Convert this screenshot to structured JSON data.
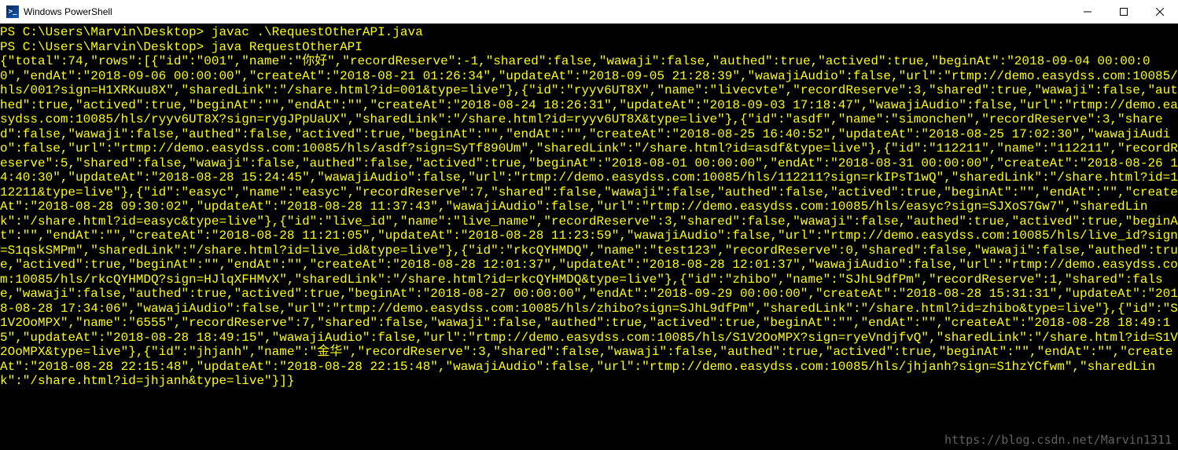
{
  "window": {
    "title": "Windows PowerShell",
    "icon_label": ">_"
  },
  "commands": [
    {
      "prompt": "PS C:\\Users\\Marvin\\Desktop> ",
      "cmd": "javac .\\RequestOtherAPI.java"
    },
    {
      "prompt": "PS C:\\Users\\Marvin\\Desktop> ",
      "cmd": "java RequestOtherAPI"
    }
  ],
  "json_output": {
    "total": 74,
    "rows": [
      {
        "id": "001",
        "name": "你好",
        "recordReserve": -1,
        "shared": false,
        "wawaji": false,
        "authed": true,
        "actived": true,
        "beginAt": "2018-09-04 00:00:00",
        "endAt": "2018-09-06 00:00:00",
        "createAt": "2018-08-21 01:26:34",
        "updateAt": "2018-09-05 21:28:39",
        "wawajiAudio": false,
        "url": "rtmp://demo.easydss.com:10085/hls/001?sign=H1XRKuu8X",
        "sharedLink": "/share.html?id=001&type=live"
      },
      {
        "id": "ryyv6UT8X",
        "name": "livecvte",
        "recordReserve": 3,
        "shared": true,
        "wawaji": false,
        "authed": true,
        "actived": true,
        "beginAt": "",
        "endAt": "",
        "createAt": "2018-08-24 18:26:31",
        "updateAt": "2018-09-03 17:18:47",
        "wawajiAudio": false,
        "url": "rtmp://demo.easydss.com:10085/hls/ryyv6UT8X?sign=rygJPpUaUX",
        "sharedLink": "/share.html?id=ryyv6UT8X&type=live"
      },
      {
        "id": "asdf",
        "name": "simonchen",
        "recordReserve": 3,
        "shared": false,
        "wawaji": false,
        "authed": false,
        "actived": true,
        "beginAt": "",
        "endAt": "",
        "createAt": "2018-08-25 16:40:52",
        "updateAt": "2018-08-25 17:02:30",
        "wawajiAudio": false,
        "url": "rtmp://demo.easydss.com:10085/hls/asdf?sign=SyTf890Um",
        "sharedLink": "/share.html?id=asdf&type=live"
      },
      {
        "id": "112211",
        "name": "112211",
        "recordReserve": 5,
        "shared": false,
        "wawaji": false,
        "authed": false,
        "actived": true,
        "beginAt": "2018-08-01 00:00:00",
        "endAt": "2018-08-31 00:00:00",
        "createAt": "2018-08-26 14:40:30",
        "updateAt": "2018-08-28 15:24:45",
        "wawajiAudio": false,
        "url": "rtmp://demo.easydss.com:10085/hls/112211?sign=rkIPsT1wQ",
        "sharedLink": "/share.html?id=112211&type=live"
      },
      {
        "id": "easyc",
        "name": "easyc",
        "recordReserve": 7,
        "shared": false,
        "wawaji": false,
        "authed": false,
        "actived": true,
        "beginAt": "",
        "endAt": "",
        "createAt": "2018-08-28 09:30:02",
        "updateAt": "2018-08-28 11:37:43",
        "wawajiAudio": false,
        "url": "rtmp://demo.easydss.com:10085/hls/easyc?sign=SJXoS7Gw7",
        "sharedLink": "/share.html?id=easyc&type=live"
      },
      {
        "id": "live_id",
        "name": "live_name",
        "recordReserve": 3,
        "shared": false,
        "wawaji": false,
        "authed": true,
        "actived": true,
        "beginAt": "",
        "endAt": "",
        "createAt": "2018-08-28 11:21:05",
        "updateAt": "2018-08-28 11:23:59",
        "wawajiAudio": false,
        "url": "rtmp://demo.easydss.com:10085/hls/live_id?sign=S1qskSMPm",
        "sharedLink": "/share.html?id=live_id&type=live"
      },
      {
        "id": "rkcQYHMDQ",
        "name": "test123",
        "recordReserve": 0,
        "shared": false,
        "wawaji": false,
        "authed": true,
        "actived": true,
        "beginAt": "",
        "endAt": "",
        "createAt": "2018-08-28 12:01:37",
        "updateAt": "2018-08-28 12:01:37",
        "wawajiAudio": false,
        "url": "rtmp://demo.easydss.com:10085/hls/rkcQYHMDQ?sign=HJlqXFHMvX",
        "sharedLink": "/share.html?id=rkcQYHMDQ&type=live"
      },
      {
        "id": "zhibo",
        "name": "SJhL9dfPm",
        "recordReserve": 1,
        "shared": false,
        "wawaji": false,
        "authed": true,
        "actived": true,
        "beginAt": "2018-08-27 00:00:00",
        "endAt": "2018-09-29 00:00:00",
        "createAt": "2018-08-28 15:31:31",
        "updateAt": "2018-08-28 17:34:06",
        "wawajiAudio": false,
        "url": "rtmp://demo.easydss.com:10085/hls/zhibo?sign=SJhL9dfPm",
        "sharedLink": "/share.html?id=zhibo&type=live"
      },
      {
        "id": "S1V2OoMPX",
        "name": "6555",
        "recordReserve": 7,
        "shared": false,
        "wawaji": false,
        "authed": true,
        "actived": true,
        "beginAt": "",
        "endAt": "",
        "createAt": "2018-08-28 18:49:15",
        "updateAt": "2018-08-28 18:49:15",
        "wawajiAudio": false,
        "url": "rtmp://demo.easydss.com:10085/hls/S1V2OoMPX?sign=ryeVndjfvQ",
        "sharedLink": "/share.html?id=S1V2OoMPX&type=live"
      },
      {
        "id": "jhjanh",
        "name": "金华",
        "recordReserve": 3,
        "shared": false,
        "wawaji": false,
        "authed": true,
        "actived": true,
        "beginAt": "",
        "endAt": "",
        "createAt": "2018-08-28 22:15:48",
        "updateAt": "2018-08-28 22:15:48",
        "wawajiAudio": false,
        "url": "rtmp://demo.easydss.com:10085/hls/jhjanh?sign=S1hzYCfwm",
        "sharedLink": "/share.html?id=jhjanh&type=live"
      }
    ]
  },
  "watermark": "https://blog.csdn.net/Marvin1311"
}
